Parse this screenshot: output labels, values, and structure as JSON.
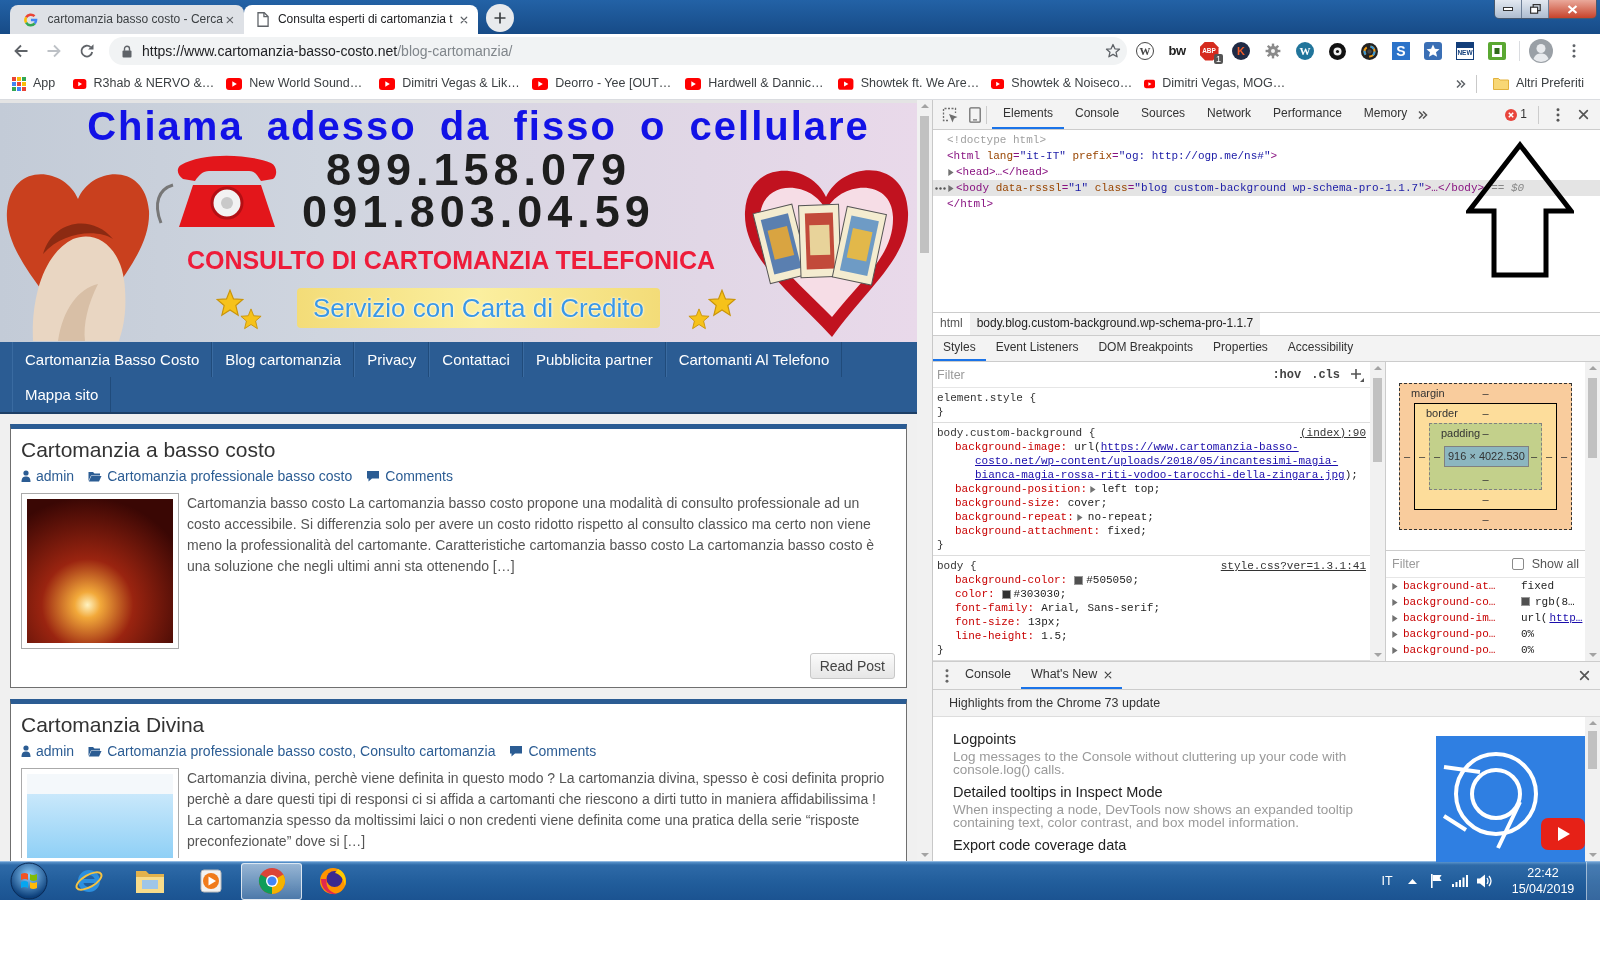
{
  "browser": {
    "tabs": [
      {
        "kind": "search",
        "title": "cartomanzia basso costo - Cerca",
        "selected": false
      },
      {
        "kind": "page",
        "title": "Consulta esperti di cartomanzia t",
        "selected": true
      }
    ],
    "nav_buttons": [
      {
        "kind": "back",
        "disabled": false
      },
      {
        "kind": "forward",
        "disabled": true
      },
      {
        "kind": "reload",
        "disabled": false
      }
    ],
    "address": {
      "host": "https://www.cartomanzia-basso-costo.net",
      "path": "/blog-cartomanzia/"
    },
    "extensions": [
      {
        "kind": "ring-disc",
        "label": "W"
      },
      {
        "kind": "wordmark",
        "label": "bw"
      },
      {
        "kind": "octagon",
        "label": "ABP",
        "badge": "1"
      },
      {
        "kind": "dark-disc",
        "label": "K"
      },
      {
        "kind": "gear"
      },
      {
        "kind": "blue-disc",
        "label": "W"
      },
      {
        "kind": "record"
      },
      {
        "kind": "lens"
      },
      {
        "kind": "s-tile",
        "label": "S"
      },
      {
        "kind": "star-tile"
      },
      {
        "kind": "new-tile",
        "label": "NEW"
      },
      {
        "kind": "frame-tile"
      }
    ],
    "bookmarks": [
      {
        "kind": "apps",
        "label": "App"
      },
      {
        "kind": "video",
        "label": "R3hab & NERVO &…"
      },
      {
        "kind": "video",
        "label": "New World Sound…"
      },
      {
        "kind": "video",
        "label": "Dimitri Vegas & Lik…"
      },
      {
        "kind": "video",
        "label": "Deorro - Yee [OUT…"
      },
      {
        "kind": "video",
        "label": "Hardwell & Dannic…"
      },
      {
        "kind": "video",
        "label": "Showtek ft. We Are…"
      },
      {
        "kind": "video",
        "label": "Showtek & Noiseco…"
      },
      {
        "kind": "video",
        "label": "Dimitri Vegas, MOG…"
      }
    ],
    "other_bookmarks": "Altri Preferiti"
  },
  "website": {
    "banner": {
      "headline": "Chiama adesso da fisso o cellulare",
      "phones": [
        "899.158.079",
        "091.803.04.59"
      ],
      "subtitle": "CONSULTO DI CARTOMANZIA TELEFONICA",
      "ribbon": "Servizio con Carta di Credito"
    },
    "menu": [
      "Cartomanzia Basso Costo",
      "Blog cartomanzia",
      "Privacy",
      "Contattaci",
      "Pubblicita partner",
      "Cartomanti Al Telefono",
      "Mappa sito"
    ],
    "posts": [
      {
        "kind": "photo",
        "title": "Cartomanzia a basso costo",
        "author": "admin",
        "category": "Cartomanzia professionale basso costo",
        "comments": "Comments",
        "excerpt": "Cartomanzia basso costo La cartomanzia basso costo propone una modalità di consulto professionale ad un costo accessibile. Si differenzia solo per avere un costo ridotto rispetto al consulto classico ma certo non viene meno la professionalità del cartomante. Caratteristiche cartomanzia basso costo La cartomanzia basso costo è una soluzione che negli ultimi anni sta ottenendo […]",
        "button": "Read Post"
      },
      {
        "kind": "graphic",
        "title": "Cartomanzia Divina",
        "author": "admin",
        "category": "Cartomanzia professionale basso costo, Consulto cartomanzia",
        "comments": "Comments",
        "excerpt": "Cartomanzia divina, perchè viene definita in questo modo ? La cartomanzia divina, spesso è cosi definita proprio perchè a dare questi tipi di responsi ci si affida a cartomanti che riescono a dirti tutto in maniera affidabilissima ! La cartomanzia spesso da moltissimi laici o non credenti viene definita come una pratica della serie “risposte preconfezionate” dove si […]"
      }
    ]
  },
  "devtools": {
    "tabs": [
      {
        "label": "Elements",
        "selected": true
      },
      {
        "label": "Console",
        "selected": false
      },
      {
        "label": "Sources",
        "selected": false
      },
      {
        "label": "Network",
        "selected": false
      },
      {
        "label": "Performance",
        "selected": false
      },
      {
        "label": "Memory",
        "selected": false
      }
    ],
    "errors": "1",
    "dom_tree": [
      {
        "kind": "doctype",
        "markup": "<!doctype html>",
        "selected": false
      },
      {
        "kind": "element",
        "markup": "<html lang=\"it-IT\" prefix=\"og: http://ogp.me/ns#\">",
        "selected": false,
        "children": [
          {
            "kind": "element",
            "markup": "<head>…</head>",
            "expanded": false,
            "selected": false
          },
          {
            "kind": "element",
            "markup": "<body data-rsssl=\"1\" class=\"blog custom-background wp-schema-pro-1.1.7\">…</body>",
            "expanded": false,
            "selected": true,
            "note": "== $0"
          }
        ],
        "close": "</html>"
      }
    ],
    "breadcrumbs": [
      {
        "label": "html",
        "selected": false
      },
      {
        "label": "body.blog.custom-background.wp-schema-pro-1.1.7",
        "selected": true
      }
    ],
    "panel_tabs": [
      {
        "label": "Styles",
        "selected": true
      },
      {
        "label": "Event Listeners",
        "selected": false
      },
      {
        "label": "DOM Breakpoints",
        "selected": false
      },
      {
        "label": "Properties",
        "selected": false
      },
      {
        "label": "Accessibility",
        "selected": false
      }
    ],
    "styles": {
      "filter": {
        "placeholder": "Filter"
      },
      "toggles": [
        ":hov",
        ".cls"
      ],
      "rules": [
        {
          "selector": "element.style {",
          "close": "}"
        },
        {
          "selector": "body.custom-background {",
          "source": "(index):90",
          "declarations": [
            {
              "property": "background-image:",
              "value": "url(",
              "link_lines": [
                "https://www.cartomanzia-basso-",
                "costo.net/wp-content/uploads/2018/05/incantesimi-magia-",
                "bianca-magia-rossa-riti-vodoo-tarocchi-della-zingara.jpg"
              ],
              "after": ");"
            },
            {
              "property": "background-position:",
              "expandable": true,
              "value": "left top;"
            },
            {
              "property": "background-size:",
              "value": "cover;"
            },
            {
              "property": "background-repeat:",
              "expandable": true,
              "value": "no-repeat;"
            },
            {
              "property": "background-attachment:",
              "value": "fixed;"
            }
          ],
          "close": "}"
        },
        {
          "selector": "body {",
          "source": "style.css?ver=1.3.1:41",
          "declarations": [
            {
              "property": "background-color:",
              "color": "#505050",
              "value": "#505050;"
            },
            {
              "property": "color:",
              "color": "#303030",
              "value": "#303030;"
            },
            {
              "property": "font-family:",
              "value": "Arial, Sans-serif;"
            },
            {
              "property": "font-size:",
              "value": "13px;"
            },
            {
              "property": "line-height:",
              "value": "1.5;"
            }
          ],
          "close": "}"
        }
      ]
    },
    "computed": {
      "box_model": {
        "layers": [
          {
            "label": "margin",
            "top": "–"
          },
          {
            "label": "border",
            "top": "–"
          },
          {
            "label": "padding",
            "top": "–"
          }
        ],
        "middle": {
          "left": [
            "–",
            "–",
            "–"
          ],
          "content": "916 × 4022.530",
          "right": [
            "–",
            "–",
            "–"
          ]
        },
        "bottoms": [
          "–",
          "–",
          "–"
        ]
      },
      "filter": {
        "placeholder": "Filter"
      },
      "show_all": {
        "label": "Show all",
        "checked": false
      },
      "properties": [
        {
          "name": "background-at…",
          "value": "fixed"
        },
        {
          "name": "background-co…",
          "color": "#505050",
          "value": "rgb(8…"
        },
        {
          "name": "background-im…",
          "value": "url(",
          "link": "http…"
        },
        {
          "name": "background-po…",
          "value": "0%"
        },
        {
          "name": "background-po…",
          "value": "0%"
        }
      ]
    },
    "drawer": {
      "tabs": [
        {
          "label": "Console",
          "selected": false,
          "closable": false
        },
        {
          "label": "What's New",
          "selected": true,
          "closable": true
        }
      ],
      "banner": "Highlights from the Chrome 73 update",
      "items": [
        {
          "title": "Logpoints",
          "description": "Log messages to the Console without cluttering up your code with console.log() calls."
        },
        {
          "title": "Detailed tooltips in Inspect Mode",
          "description": "When inspecting a node, DevTools now shows an expanded tooltip containing text, color contrast, and box model information."
        },
        {
          "title": "Export code coverage data"
        }
      ]
    }
  },
  "taskbar": {
    "apps": [
      {
        "kind": "ie",
        "selected": false
      },
      {
        "kind": "explorer",
        "selected": false
      },
      {
        "kind": "media",
        "selected": false
      },
      {
        "kind": "chrome",
        "selected": true
      },
      {
        "kind": "firefox",
        "selected": false
      }
    ],
    "language": "IT",
    "time": "22:42",
    "date": "15/04/2019"
  }
}
